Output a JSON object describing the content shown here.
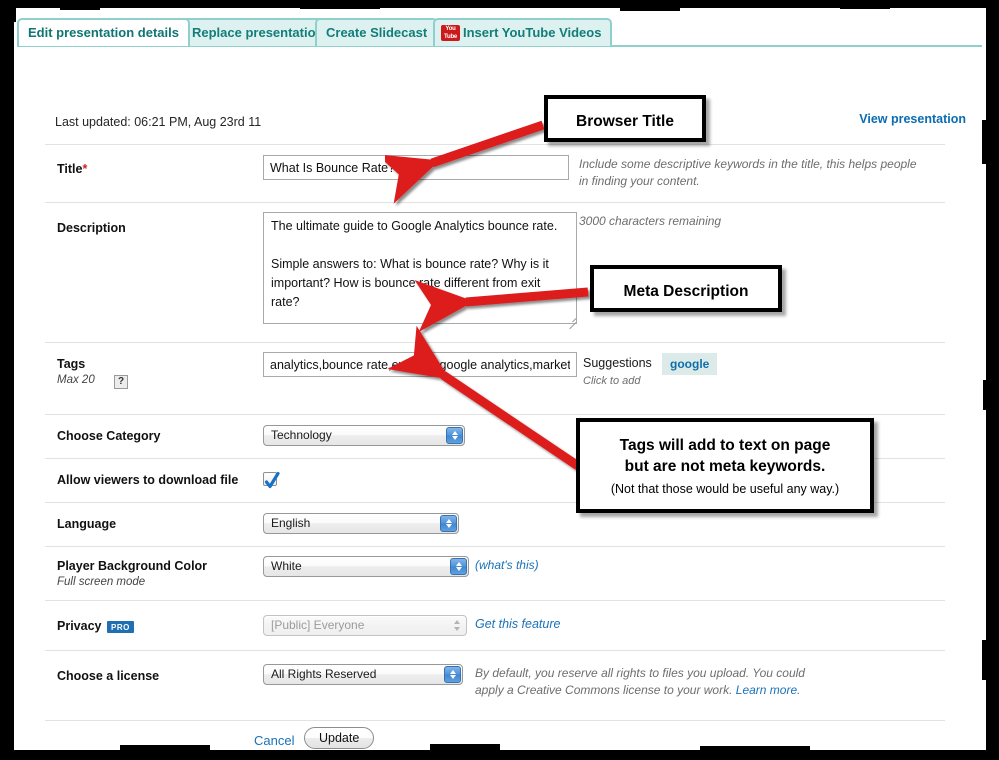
{
  "tabs": [
    {
      "label": "Edit presentation details",
      "active": true
    },
    {
      "label": "Replace presentation",
      "active": false
    },
    {
      "label": "Create Slidecast",
      "active": false
    },
    {
      "label": "Insert YouTube Videos",
      "active": false,
      "icon": "youtube-icon",
      "icon_top": "You",
      "icon_bottom": "Tube"
    }
  ],
  "header": {
    "view_presentation": "View presentation",
    "last_updated": "Last updated: 06:21 PM, Aug 23rd 11"
  },
  "form": {
    "title": {
      "label": "Title",
      "required_mark": "*",
      "value": "What Is Bounce Rate?",
      "hint": "Include some descriptive keywords in the title, this helps people in finding your content."
    },
    "description": {
      "label": "Description",
      "value": "The ultimate guide to Google Analytics bounce rate.\n\nSimple answers to: What is bounce rate? Why is it important? How is bounce rate different from exit rate?",
      "counter": "3000 characters remaining"
    },
    "tags": {
      "label": "Tags",
      "sublabel": "Max 20",
      "help_badge": "?",
      "value": "analytics,bounce rate,exit rate,google analytics,marketir",
      "suggestions_label": "Suggestions",
      "suggestions_sub": "Click to add",
      "suggestion_chips": [
        "google"
      ]
    },
    "category": {
      "label": "Choose Category",
      "value": "Technology",
      "options": [
        "Technology"
      ]
    },
    "download": {
      "label": "Allow viewers to download file",
      "checked": true
    },
    "language": {
      "label": "Language",
      "value": "English",
      "options": [
        "English"
      ]
    },
    "player_background": {
      "label": "Player Background Color",
      "sublabel": "Full screen mode",
      "value": "White",
      "options": [
        "White"
      ],
      "link": "(what's this)"
    },
    "privacy": {
      "label": "Privacy",
      "badge": "PRO",
      "value": "[Public] Everyone",
      "options": [
        "[Public] Everyone"
      ],
      "link": "Get this feature",
      "disabled": true
    },
    "license": {
      "label": "Choose a license",
      "value": "All Rights Reserved",
      "options": [
        "All Rights Reserved"
      ],
      "hint_part1": "By default, you reserve all rights to files you upload. You could apply a Creative Commons license to your work. ",
      "hint_link": "Learn more."
    }
  },
  "footer": {
    "cancel": "Cancel",
    "update": "Update"
  },
  "annotations": [
    {
      "text": "Browser Title",
      "target": "title-field"
    },
    {
      "text": "Meta Description",
      "target": "description-field"
    },
    {
      "line1": "Tags will add to text on page",
      "line2": "but are not meta keywords.",
      "line3": "(Not that those would be useful any way.)",
      "target": "tags-field"
    }
  ],
  "colors": {
    "tab_teal": "#0f7672",
    "tab_border": "#8fd0cd",
    "link_blue": "#0a6cb3",
    "arrow_red": "#dd1f1f",
    "chip_bg": "#dcebe9",
    "pro_badge": "#1f6fb2"
  }
}
